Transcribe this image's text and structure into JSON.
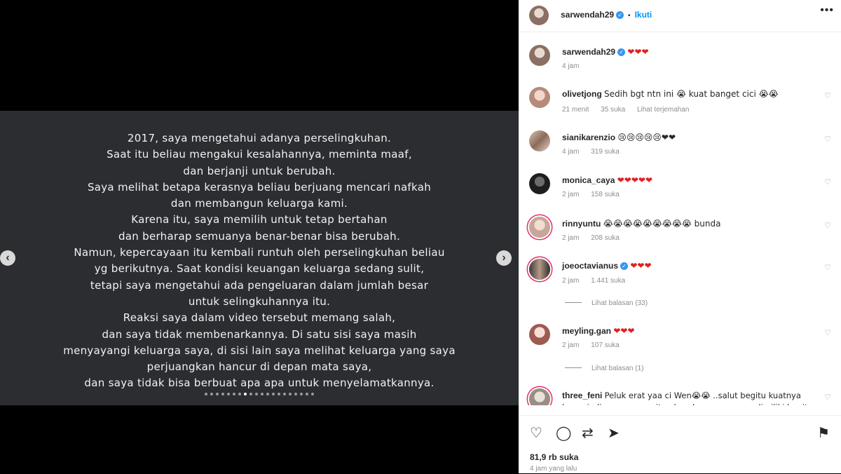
{
  "slide": {
    "lines": [
      "2017, saya mengetahui adanya perselingkuhan.",
      "Saat itu beliau mengakui kesalahannya, meminta maaf,",
      "dan berjanji untuk berubah.",
      "Saya melihat betapa kerasnya beliau berjuang mencari nafkah",
      "dan membangun keluarga kami.",
      "Karena itu, saya memilih untuk tetap bertahan",
      "dan berharap semuanya benar-benar bisa berubah.",
      "Namun, kepercayaan itu kembali runtuh oleh perselingkuhan beliau",
      "yg berikutnya. Saat kondisi keuangan keluarga sedang sulit,",
      "tetapi saya mengetahui ada pengeluaran dalam jumlah besar",
      "untuk selingkuhannya itu.",
      "Reaksi saya dalam video tersebut memang salah,",
      "dan saya tidak membenarkannya. Di satu sisi saya masih",
      "menyayangi keluarga saya, di sisi lain saya melihat keluarga yang saya",
      "perjuangkan hancur di depan mata saya,",
      "dan saya tidak bisa berbuat apa apa untuk menyelamatkannya."
    ],
    "prev_icon": "‹",
    "next_icon": "›",
    "dots_total": 20,
    "dots_active_index": 7
  },
  "header": {
    "username": "sarwendah29",
    "verified_icon": "✓",
    "separator": "•",
    "follow_label": "Ikuti",
    "more_icon": "•••"
  },
  "caption": {
    "username": "sarwendah29",
    "text": "❤❤❤",
    "time": "4 jam"
  },
  "comments": [
    {
      "username": "olivetjong",
      "text": "Sedih bgt ntn ini 😭 kuat banget cici 😭😭",
      "time": "21 menit",
      "likes": "35 suka",
      "extra": "Lihat terjemahan"
    },
    {
      "username": "sianikarenzio",
      "text": "😢😢😢😢😢❤❤",
      "time": "4 jam",
      "likes": "319 suka",
      "extra": ""
    },
    {
      "username": "monica_caya",
      "text": "❤❤❤❤❤",
      "time": "2 jam",
      "likes": "158 suka",
      "extra": ""
    },
    {
      "username": "rinnyuntu",
      "text": "😭😭😭😭😭😭😭😭😭 bunda",
      "time": "2 jam",
      "likes": "208 suka",
      "extra": ""
    },
    {
      "username": "joeoctavianus",
      "text": "❤❤❤",
      "time": "2 jam",
      "likes": "1.441 suka",
      "extra": "",
      "replies": "Lihat balasan (33)"
    },
    {
      "username": "meyling.gan",
      "text": "❤❤❤",
      "time": "2 jam",
      "likes": "107 suka",
      "extra": "",
      "replies": "Lihat balasan (1)"
    },
    {
      "username": "three_feni",
      "text": "Peluk erat yaa ci Wen😭😭 ..salut begitu kuatnya kamu jadi seorang wanita.. kesabarannya yang dimiliki begitu"
    }
  ],
  "actions": {
    "like_icon": "♡",
    "comment_icon": "◯",
    "share_icon": "⇄",
    "send_icon": "➤",
    "save_icon": "⚑",
    "likes": "81,9 rb suka",
    "time_ago": "4 jam yang lalu"
  },
  "colors": {
    "slide_bg": "#2b2d31",
    "accent_blue": "#0095f6",
    "heart_red": "#e02020",
    "meta_gray": "#8e8e8e"
  }
}
